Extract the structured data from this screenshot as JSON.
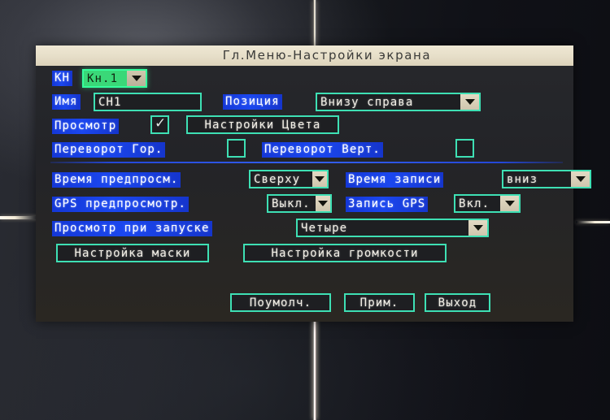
{
  "window": {
    "title": "Гл.Меню-Настройки экрана"
  },
  "rows": {
    "channel": {
      "label": "КН",
      "value": "Кн.1",
      "icon": "chevron-down-icon"
    },
    "name": {
      "label": "Имя",
      "value": "CH1"
    },
    "position": {
      "label": "Позиция",
      "value": "Внизу справа",
      "icon": "chevron-down-icon"
    },
    "preview": {
      "label": "Просмотр",
      "checked": true,
      "check_glyph": "✓"
    },
    "color_settings": {
      "label": "Настройки Цвета"
    },
    "flip_h": {
      "label": "Переворот Гор.",
      "checked": false
    },
    "flip_v": {
      "label": "Переворот Верт.",
      "checked": false
    },
    "preview_time": {
      "label": "Время предпросм.",
      "value": "Сверху",
      "icon": "chevron-down-icon"
    },
    "record_time": {
      "label": "Время записи",
      "value": "вниз",
      "icon": "chevron-down-icon"
    },
    "gps_preview": {
      "label": "GPS предпросмотр.",
      "value": "Выкл.",
      "icon": "chevron-down-icon"
    },
    "gps_record": {
      "label": "Запись GPS",
      "value": "Вкл.",
      "icon": "chevron-down-icon"
    },
    "startup_view": {
      "label": "Просмотр при запуске",
      "value": "Четыре",
      "icon": "chevron-down-icon"
    },
    "mask_settings": {
      "label": "Настройка маски"
    },
    "volume_settings": {
      "label": "Настройка громкости"
    }
  },
  "footer": {
    "default_label": "Поумолч.",
    "apply_label": "Прим.",
    "exit_label": "Выход"
  },
  "colors": {
    "title_bar": "#e6dec8",
    "label_blue": "#1b47ef",
    "field_outline": "#3ee0b4",
    "focus_green": "#3ad878",
    "arrow_face": "#e3dac4",
    "dialog_bg": "#27282c"
  }
}
